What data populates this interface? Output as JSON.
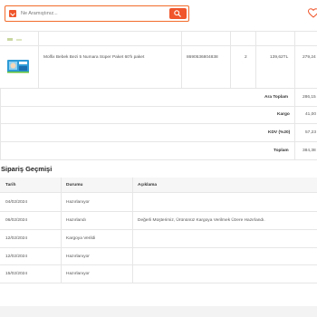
{
  "search": {
    "placeholder": "Ne Aramıştınız..."
  },
  "header": {
    "favorites_icon": "heart-icon",
    "search_icon": "search-icon"
  },
  "order": {
    "row": {
      "name": "Molfix Bebek Bezi 5 Numara Süper Paket 60'lı paket",
      "barcode": "8690536804838",
      "quantity": "2",
      "unit_price": "139,62TL",
      "total": "279,24"
    },
    "summary": [
      {
        "label": "Ara Toplam",
        "value": "286,15"
      },
      {
        "label": "Kargo",
        "value": "41,00"
      },
      {
        "label": "KDV (%20)",
        "value": "57,23"
      },
      {
        "label": "Toplam",
        "value": "384,38"
      }
    ]
  },
  "history": {
    "title": "Sipariş Geçmişi",
    "columns": [
      "Tarih",
      "Durumu",
      "Açıklama"
    ],
    "rows": [
      {
        "date": "04/02/2024",
        "status": "Hazırlanıyor",
        "note": ""
      },
      {
        "date": "06/02/2024",
        "status": "Hazırlandı",
        "note": "Değerli Müşterimiz, Ürününüz Kargoya Verilmek Üzere Hazırlandı."
      },
      {
        "date": "12/02/2024",
        "status": "Kargoya Verildi",
        "note": ""
      },
      {
        "date": "12/02/2024",
        "status": "Hazırlanıyor",
        "note": ""
      },
      {
        "date": "15/02/2024",
        "status": "Hazırlanıyor",
        "note": ""
      }
    ]
  },
  "colors": {
    "accent": "#f0552b",
    "border": "#e6e6e6",
    "header_bg": "#f6f6f6"
  }
}
